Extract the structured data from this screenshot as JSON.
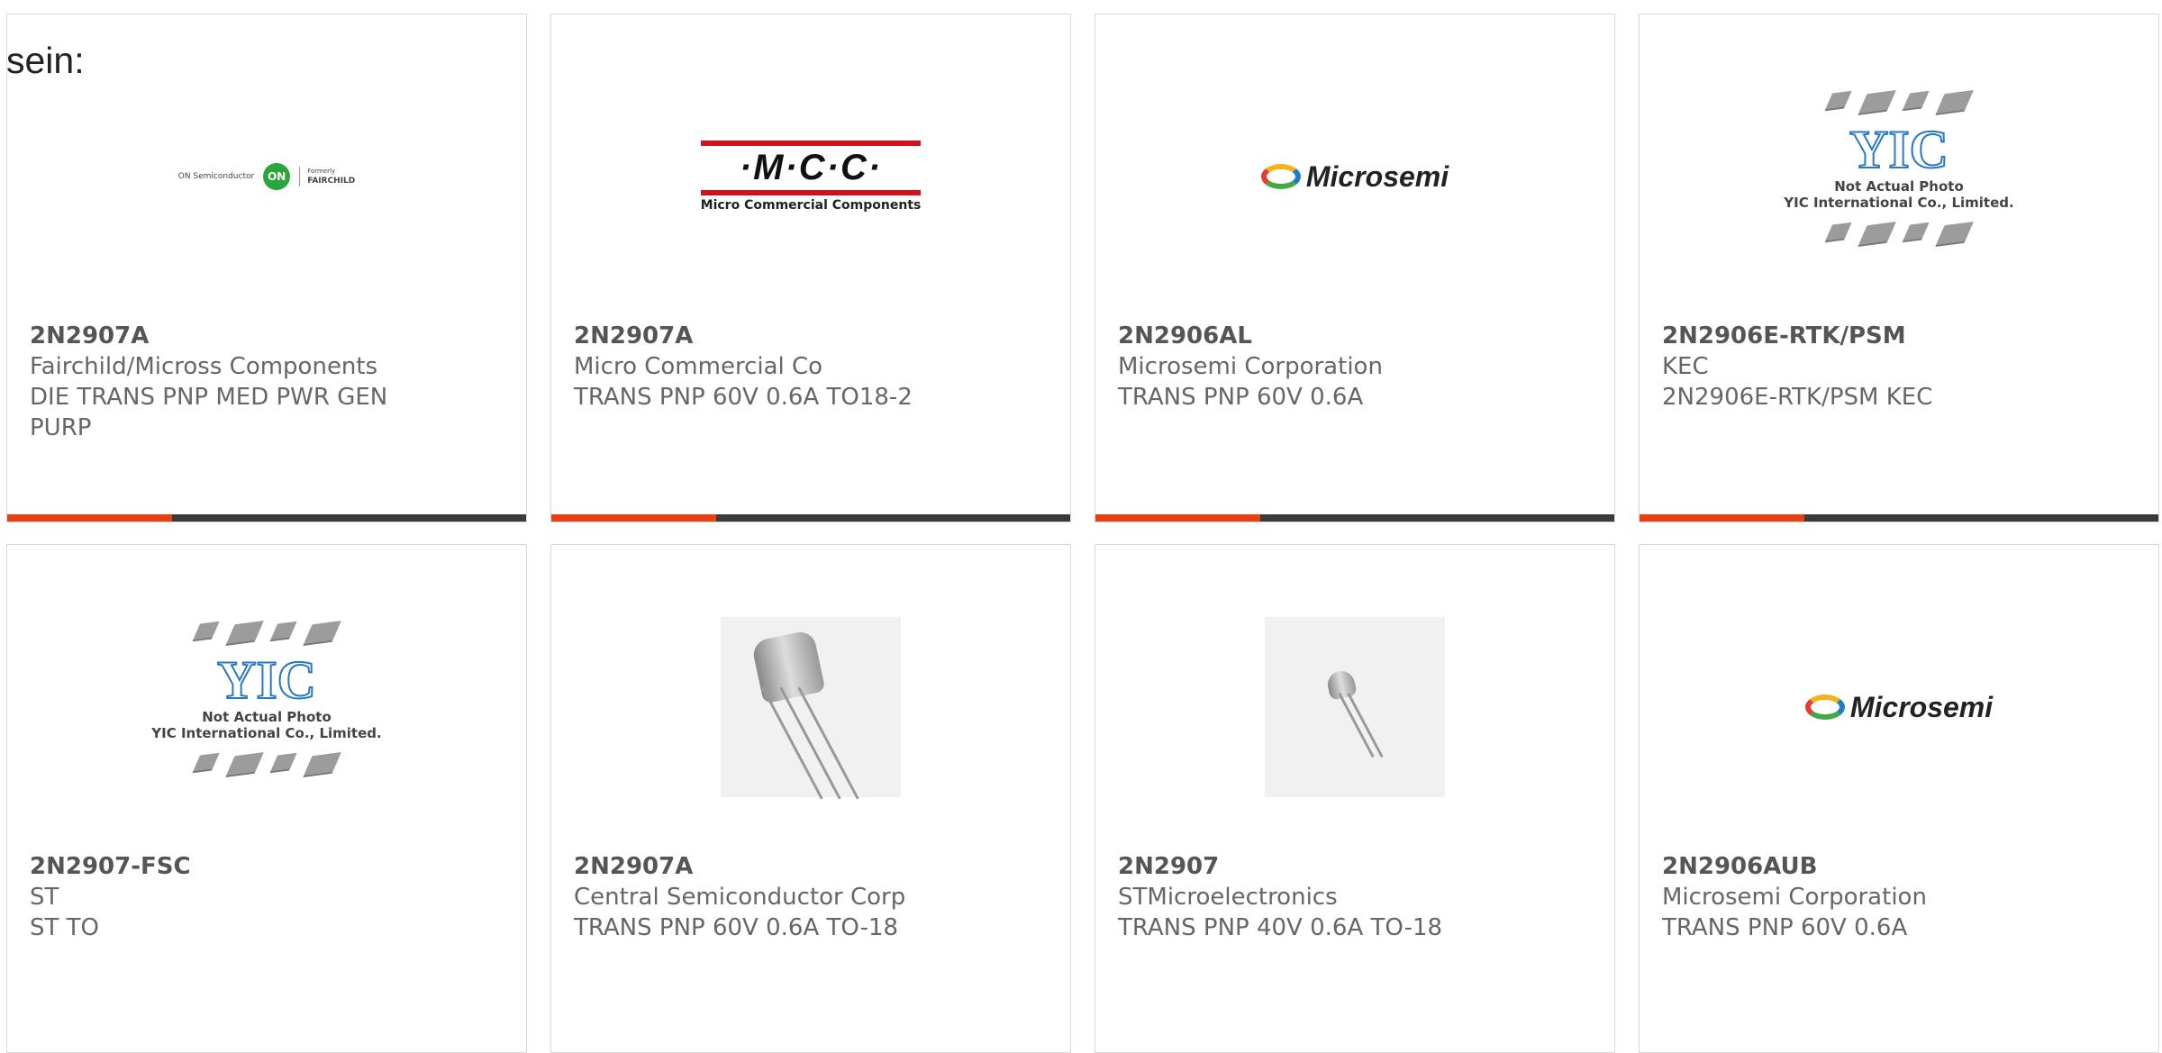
{
  "intro": "sein:",
  "products": [
    {
      "part": "2N2907A",
      "maker": "Fairchild/Micross Components",
      "desc": "DIE TRANS PNP MED PWR GEN PURP",
      "logo": "on-semi-fairchild-logo"
    },
    {
      "part": "2N2907A",
      "maker": "Micro Commercial Co",
      "desc": "TRANS PNP 60V 0.6A TO18-2",
      "logo": "mcc-logo"
    },
    {
      "part": "2N2906AL",
      "maker": "Microsemi Corporation",
      "desc": "TRANS PNP 60V 0.6A",
      "logo": "microsemi-logo"
    },
    {
      "part": "2N2906E-RTK/PSM",
      "maker": "KEC",
      "desc": "2N2906E-RTK/PSM KEC",
      "logo": "yic-placeholder"
    },
    {
      "part": "2N2907-FSC",
      "maker": "ST",
      "desc": "ST TO",
      "logo": "yic-placeholder"
    },
    {
      "part": "2N2907A",
      "maker": "Central Semiconductor Corp",
      "desc": "TRANS PNP 60V 0.6A TO-18",
      "logo": "to18-photo"
    },
    {
      "part": "2N2907",
      "maker": "STMicroelectronics",
      "desc": "TRANS PNP 40V 0.6A TO-18",
      "logo": "to18-photo-small"
    },
    {
      "part": "2N2906AUB",
      "maker": "Microsemi Corporation",
      "desc": "TRANS PNP 60V 0.6A",
      "logo": "microsemi-logo"
    }
  ],
  "logos": {
    "on_semi": "ON Semiconductor",
    "on_mark": "ON",
    "fairchild_pre": "Formerly",
    "fairchild": "FAIRCHILD",
    "mcc_mark": "·M·C·C·",
    "mcc_name": "Micro Commercial Components",
    "microsemi": "Microsemi",
    "yic_mark": "YIC",
    "yic_cap1": "Not Actual Photo",
    "yic_cap2": "YIC International Co., Limited."
  },
  "colors": {
    "accent": "#e84012",
    "bar": "#3a3a3a",
    "text": "#666666",
    "border": "#d8d8d8"
  }
}
